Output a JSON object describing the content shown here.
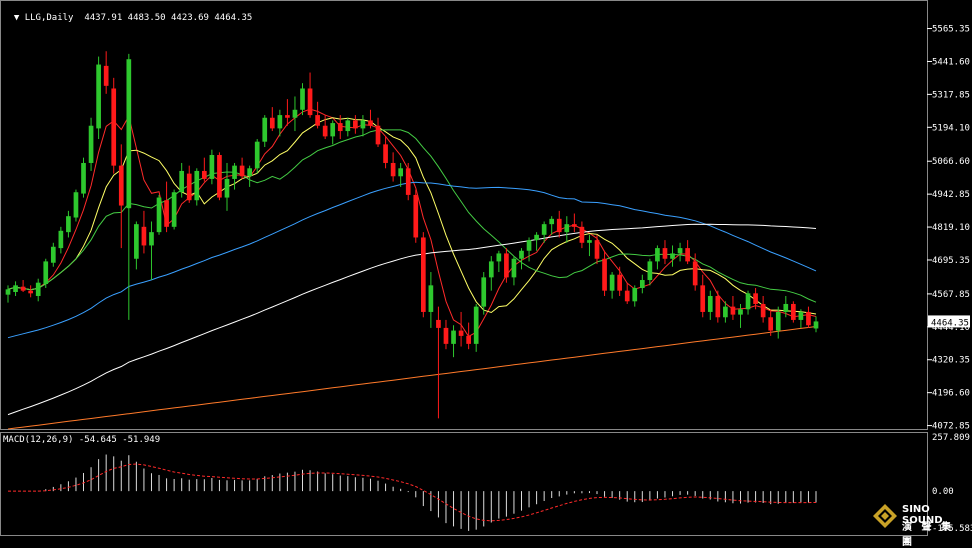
{
  "header": {
    "symbol": "LLG,Daily",
    "ohlc": "4437.91 4483.50 4423.69 4464.35",
    "macd_label": "MACD(12,26,9) -54.645 -51.949"
  },
  "icons": {
    "header_arrow": "triangle-down-icon"
  },
  "colors": {
    "background": "#000000",
    "axis": "#ffffff",
    "bull": "#2ec82e",
    "bear": "#ff1a1a",
    "ma5": "#ff2a2a",
    "ma10": "#ffff66",
    "ma20": "#44cc44",
    "ma60": "#3aa0ff",
    "ma120": "#ffffff",
    "ma250": "#ff7a2a",
    "signal": "#ff2a2a",
    "price_box": "#ffffff"
  },
  "logo": {
    "name": "SINO SOUND",
    "subtitle": "演 聲 集 團"
  },
  "chart_data": [
    {
      "type": "candlestick",
      "title": "LLG,Daily",
      "y_ticks": [
        "5565.35",
        "5441.60",
        "5317.85",
        "5194.10",
        "5066.60",
        "4942.85",
        "4819.10",
        "4695.35",
        "4567.85",
        "4444.10",
        "4320.35",
        "4196.60",
        "4072.85"
      ],
      "ylim": [
        4060.0,
        5620.0
      ],
      "last_price_label": "4464.35",
      "candles": [
        [
          4565,
          4600,
          4535,
          4585
        ],
        [
          4575,
          4615,
          4560,
          4600
        ],
        [
          4595,
          4620,
          4575,
          4580
        ],
        [
          4580,
          4600,
          4555,
          4570
        ],
        [
          4560,
          4625,
          4540,
          4610
        ],
        [
          4605,
          4700,
          4590,
          4690
        ],
        [
          4685,
          4760,
          4670,
          4745
        ],
        [
          4740,
          4820,
          4720,
          4805
        ],
        [
          4800,
          4880,
          4780,
          4860
        ],
        [
          4855,
          4960,
          4840,
          4950
        ],
        [
          4945,
          5080,
          4930,
          5060
        ],
        [
          5060,
          5230,
          5030,
          5200
        ],
        [
          5190,
          5460,
          5150,
          5430
        ],
        [
          5425,
          5480,
          5320,
          5350
        ],
        [
          5340,
          5380,
          5020,
          5050
        ],
        [
          5050,
          5130,
          4740,
          4900
        ],
        [
          4890,
          5470,
          4470,
          5450
        ],
        [
          4700,
          4840,
          4660,
          4830
        ],
        [
          4820,
          4880,
          4720,
          4750
        ],
        [
          4750,
          4840,
          4620,
          4800
        ],
        [
          4800,
          4940,
          4790,
          4930
        ],
        [
          4920,
          4990,
          4800,
          4820
        ],
        [
          4820,
          4960,
          4810,
          4950
        ],
        [
          4950,
          5060,
          4930,
          5030
        ],
        [
          5020,
          5050,
          4910,
          4920
        ],
        [
          4920,
          5040,
          4900,
          5030
        ],
        [
          5030,
          5080,
          4990,
          5000
        ],
        [
          5000,
          5110,
          4980,
          5090
        ],
        [
          5090,
          5100,
          4920,
          4930
        ],
        [
          4930,
          5060,
          4880,
          5000
        ],
        [
          5000,
          5060,
          4960,
          5050
        ],
        [
          5050,
          5080,
          5000,
          5010
        ],
        [
          5010,
          5050,
          4970,
          5040
        ],
        [
          5040,
          5150,
          5020,
          5140
        ],
        [
          5140,
          5240,
          5120,
          5230
        ],
        [
          5230,
          5270,
          5180,
          5190
        ],
        [
          5190,
          5260,
          5160,
          5240
        ],
        [
          5240,
          5300,
          5200,
          5230
        ],
        [
          5230,
          5310,
          5180,
          5260
        ],
        [
          5260,
          5360,
          5240,
          5340
        ],
        [
          5340,
          5400,
          5230,
          5240
        ],
        [
          5240,
          5290,
          5190,
          5200
        ],
        [
          5200,
          5240,
          5150,
          5160
        ],
        [
          5160,
          5220,
          5130,
          5210
        ],
        [
          5210,
          5240,
          5150,
          5180
        ],
        [
          5180,
          5230,
          5160,
          5220
        ],
        [
          5220,
          5240,
          5170,
          5190
        ],
        [
          5190,
          5240,
          5160,
          5220
        ],
        [
          5220,
          5260,
          5190,
          5200
        ],
        [
          5200,
          5230,
          5120,
          5130
        ],
        [
          5130,
          5160,
          5040,
          5060
        ],
        [
          5060,
          5100,
          4990,
          5010
        ],
        [
          5010,
          5060,
          4970,
          5040
        ],
        [
          5040,
          5060,
          4920,
          4940
        ],
        [
          4940,
          4960,
          4760,
          4780
        ],
        [
          4780,
          4800,
          4480,
          4500
        ],
        [
          4500,
          4650,
          4440,
          4600
        ],
        [
          4470,
          4520,
          4100,
          4440
        ],
        [
          4440,
          4470,
          4360,
          4380
        ],
        [
          4380,
          4450,
          4330,
          4430
        ],
        [
          4430,
          4500,
          4370,
          4410
        ],
        [
          4410,
          4460,
          4360,
          4380
        ],
        [
          4380,
          4530,
          4350,
          4520
        ],
        [
          4520,
          4650,
          4490,
          4630
        ],
        [
          4630,
          4710,
          4580,
          4690
        ],
        [
          4690,
          4730,
          4650,
          4720
        ],
        [
          4720,
          4740,
          4610,
          4630
        ],
        [
          4630,
          4710,
          4600,
          4700
        ],
        [
          4700,
          4740,
          4660,
          4730
        ],
        [
          4730,
          4780,
          4690,
          4770
        ],
        [
          4770,
          4800,
          4730,
          4790
        ],
        [
          4790,
          4840,
          4760,
          4830
        ],
        [
          4830,
          4860,
          4790,
          4850
        ],
        [
          4850,
          4880,
          4780,
          4800
        ],
        [
          4800,
          4860,
          4760,
          4830
        ],
        [
          4830,
          4870,
          4800,
          4820
        ],
        [
          4820,
          4840,
          4740,
          4760
        ],
        [
          4760,
          4790,
          4710,
          4770
        ],
        [
          4770,
          4790,
          4680,
          4700
        ],
        [
          4700,
          4730,
          4560,
          4580
        ],
        [
          4580,
          4650,
          4550,
          4640
        ],
        [
          4640,
          4670,
          4560,
          4580
        ],
        [
          4580,
          4610,
          4530,
          4540
        ],
        [
          4540,
          4600,
          4520,
          4590
        ],
        [
          4590,
          4640,
          4570,
          4620
        ],
        [
          4620,
          4700,
          4600,
          4690
        ],
        [
          4690,
          4750,
          4660,
          4740
        ],
        [
          4740,
          4770,
          4680,
          4700
        ],
        [
          4700,
          4750,
          4670,
          4720
        ],
        [
          4720,
          4760,
          4690,
          4740
        ],
        [
          4740,
          4770,
          4680,
          4690
        ],
        [
          4690,
          4720,
          4580,
          4600
        ],
        [
          4600,
          4640,
          4480,
          4500
        ],
        [
          4500,
          4580,
          4470,
          4560
        ],
        [
          4560,
          4580,
          4460,
          4480
        ],
        [
          4480,
          4540,
          4460,
          4520
        ],
        [
          4520,
          4560,
          4470,
          4490
        ],
        [
          4490,
          4530,
          4440,
          4510
        ],
        [
          4510,
          4580,
          4490,
          4570
        ],
        [
          4570,
          4590,
          4510,
          4530
        ],
        [
          4530,
          4560,
          4460,
          4480
        ],
        [
          4480,
          4510,
          4410,
          4430
        ],
        [
          4430,
          4520,
          4400,
          4500
        ],
        [
          4500,
          4560,
          4480,
          4530
        ],
        [
          4530,
          4540,
          4460,
          4470
        ],
        [
          4470,
          4510,
          4440,
          4500
        ],
        [
          4500,
          4520,
          4440,
          4450
        ],
        [
          4437.91,
          4483.5,
          4423.69,
          4464.35
        ]
      ],
      "moving_averages": [
        {
          "name": "MA5",
          "color": "#ff2a2a",
          "period": 5
        },
        {
          "name": "MA10",
          "color": "#ffff66",
          "period": 10
        },
        {
          "name": "MA20",
          "color": "#44cc44",
          "period": 20
        },
        {
          "name": "MA60",
          "color": "#3aa0ff",
          "period": 60
        },
        {
          "name": "MA120",
          "color": "#ffffff",
          "period": 120
        },
        {
          "name": "MA250",
          "color": "#ff7a2a",
          "period": 250
        }
      ]
    },
    {
      "type": "histogram",
      "title": "MACD(12,26,9) -54.645 -51.949",
      "y_ticks": [
        "257.809",
        "0.00",
        "-175.583"
      ],
      "ylim": [
        -175.583,
        257.809
      ],
      "macd_value": -54.645,
      "signal_value": -51.949
    }
  ]
}
